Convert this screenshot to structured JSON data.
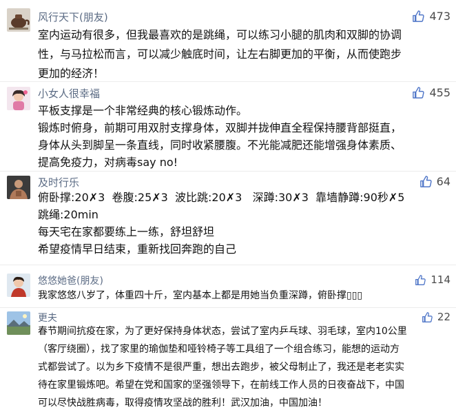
{
  "colors": {
    "username": "#5b6b84",
    "like_icon": "#4f76c8",
    "text": "#111111",
    "divider": "#ececec"
  },
  "comments": [
    {
      "username": "风行天下(朋友)",
      "likes": "473",
      "avatar": "teapot-avatar",
      "lines": [
        "室内运动有很多，但我最喜欢的是跳绳，可以练习小腿的肌肉和双脚的协调",
        "性，与马拉松而言，可以减少触底时间，让左右脚更加的平衡，从而使跑步",
        "更加的经济！"
      ]
    },
    {
      "username": "小女人很幸福",
      "likes": "455",
      "avatar": "girl-avatar",
      "lines": [
        "平板支撑是一个非常经典的核心锻炼动作。",
        "锻炼时俯身，前期可用双肘支撑身体，双脚并拢伸直全程保持腰背部挺直，",
        "身体从头到脚呈一条直线，同时收紧腰腹。不光能减肥还能增强身体素质、",
        "提高免疫力，对病毒say no!"
      ]
    },
    {
      "username": "及时行乐",
      "likes": "64",
      "avatar": "man-avatar",
      "lines": [
        "俯卧撑:20✗3  卷腹:25✗3  波比跳:20✗3   深蹲:30✗3  靠墙静蹲:90秒✗5",
        "跳绳:20min",
        "每天宅在家都要练上一练，舒坦舒坦",
        "希望疫情早日结束，重新找回奔跑的自己"
      ]
    },
    {
      "username": "悠悠她爸(朋友)",
      "likes": "114",
      "avatar": "child-avatar",
      "lines": [
        "我家悠悠八岁了，体重四十斤，室内基本上都是用她当负重深蹲，俯卧撑▯▯▯"
      ]
    },
    {
      "username": "更夫",
      "likes": "22",
      "avatar": "landscape-avatar",
      "lines": [
        "春节期间抗疫在家，为了更好保持身体状态，尝试了室内乒乓球、羽毛球，室内10公里",
        "（客厅绕圈），找了家里的瑜伽垫和哑铃椅子等工具组了一个组合练习，能想的运动方",
        "式都尝试了。以为乡下疫情不是很严重，想出去跑步，被父母制止了，我还是老老实实",
        "待在家里锻炼吧。希望在党和国家的坚强领导下，在前线工作人员的日夜奋战下，中国",
        "可以尽快战胜病毒，取得疫情攻坚战的胜利！武汉加油，中国加油！"
      ]
    }
  ]
}
